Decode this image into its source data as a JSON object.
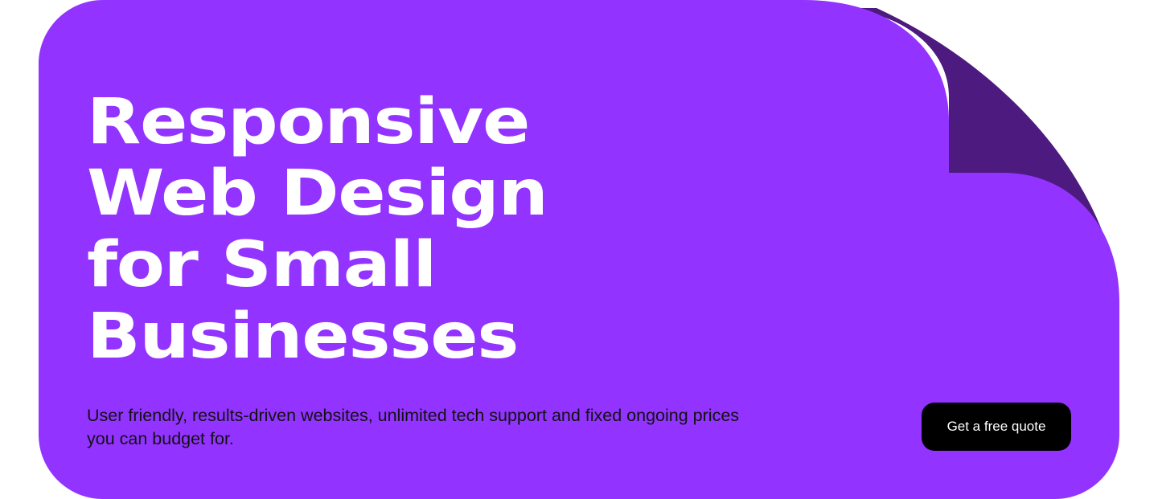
{
  "theme": {
    "card_color": "#9333FF",
    "fold_color": "#4D1A7F",
    "title_color": "#FFFFFF",
    "body_color": "#111111",
    "button_bg": "#000000",
    "button_text_color": "#FFFFFF"
  },
  "hero": {
    "title_lines": [
      "Responsive",
      "Web Design",
      "for Small",
      "Businesses"
    ],
    "subtitle": "User friendly, results-driven websites, unlimited tech support and fixed ongoing prices you can budget for.",
    "cta_label": "Get a free quote"
  }
}
